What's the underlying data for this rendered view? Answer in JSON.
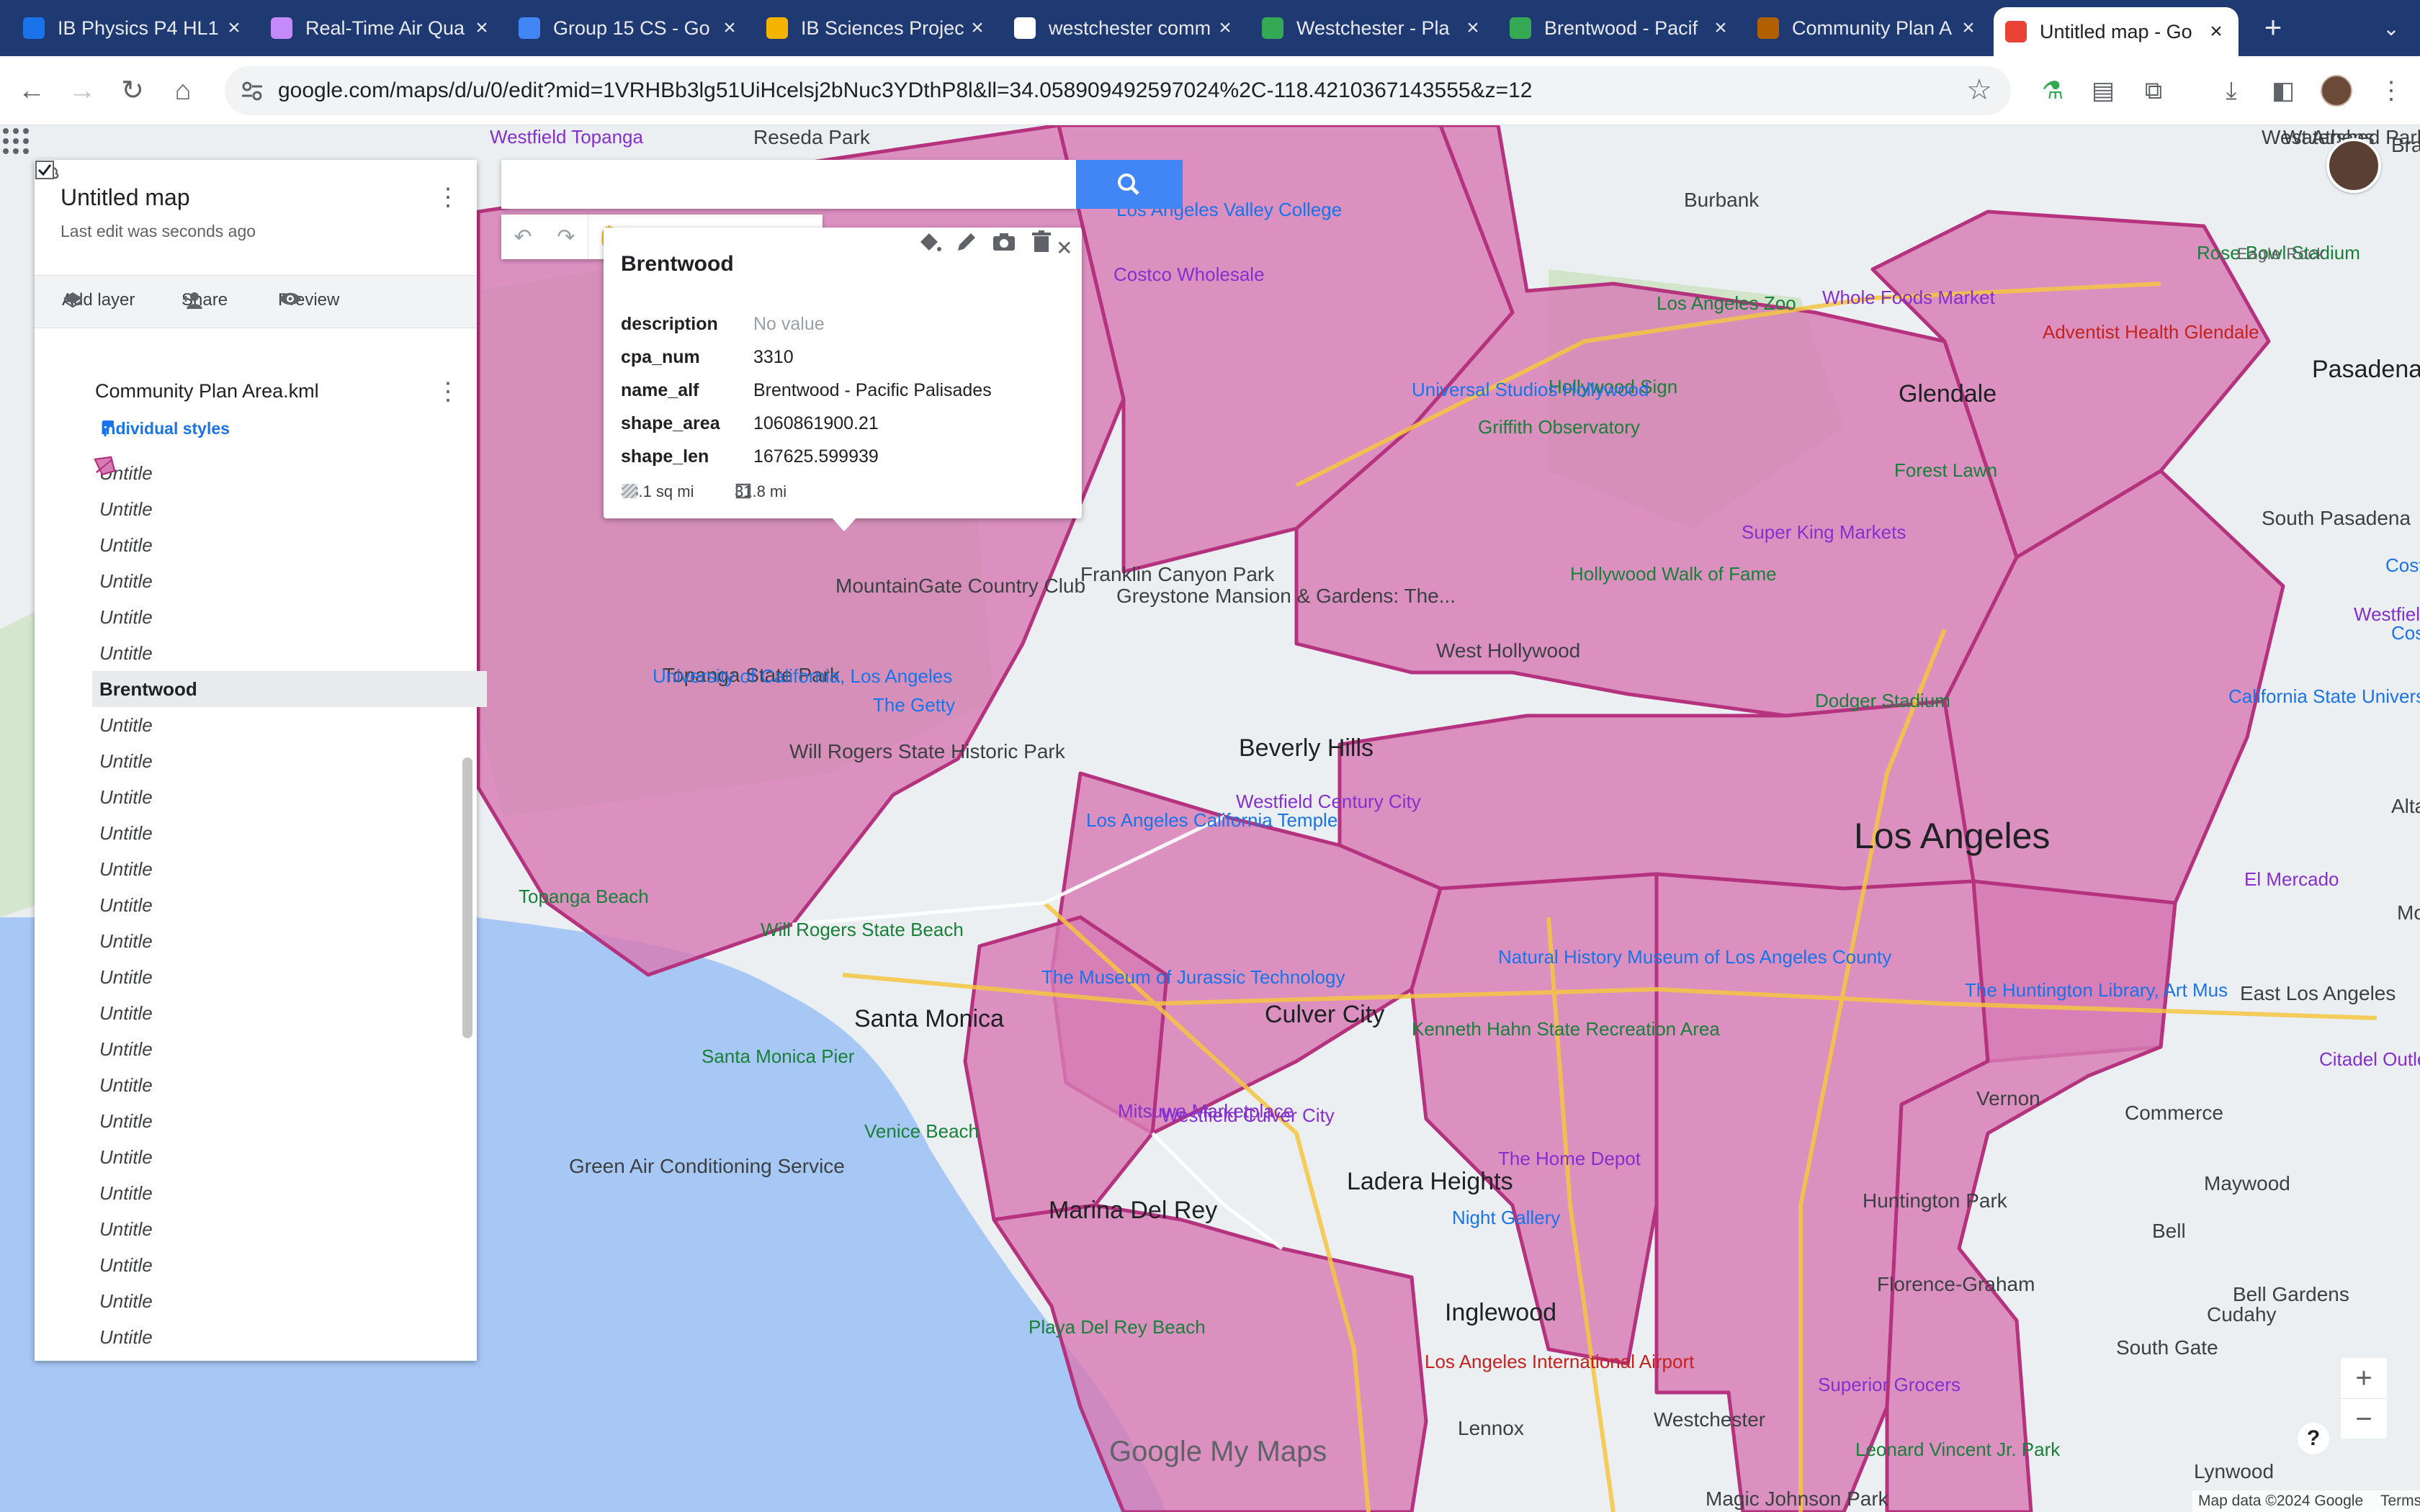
{
  "browser": {
    "tabs": [
      {
        "label": "IB Physics P4 HL1",
        "favicon": "blue-classroom-icon",
        "color": "#1a73e8"
      },
      {
        "label": "Real-Time Air Qua",
        "favicon": "cloud-icon",
        "color": "#c58af9"
      },
      {
        "label": "Group 15 CS - Go",
        "favicon": "docs-icon",
        "color": "#4285f4"
      },
      {
        "label": "IB Sciences Projec",
        "favicon": "slides-icon",
        "color": "#f4b400"
      },
      {
        "label": "westchester comm",
        "favicon": "google-icon",
        "color": "#ffffff"
      },
      {
        "label": "Westchester - Pla",
        "favicon": "maps-icon",
        "color": "#34a853"
      },
      {
        "label": "Brentwood - Pacif",
        "favicon": "maps-icon",
        "color": "#34a853"
      },
      {
        "label": "Community Plan A",
        "favicon": "city-seal-icon",
        "color": "#b06000"
      },
      {
        "label": "Untitled map - Go",
        "favicon": "mymaps-icon",
        "color": "#ea4335"
      }
    ],
    "active_tab_index": 8,
    "url": "google.com/maps/d/u/0/edit?mid=1VRHBb3lg51UiHcelsj2bNuc3YDthP8l&ll=34.058909492597024%2C-118.4210367143555&z=12"
  },
  "panel": {
    "title": "Untitled map",
    "subtitle": "Last edit was seconds ago",
    "actions": {
      "add_layer": "Add layer",
      "share": "Share",
      "preview": "Preview"
    },
    "layer": {
      "name": "Community Plan Area.kml",
      "checked": true,
      "styles_link": "Individual styles"
    },
    "features": [
      "Untitle",
      "Untitle",
      "Untitle",
      "Untitle",
      "Untitle",
      "Untitle",
      "Brentwood",
      "Untitle",
      "Untitle",
      "Untitle",
      "Untitle",
      "Untitle",
      "Untitle",
      "Untitle",
      "Untitle",
      "Untitle",
      "Untitle",
      "Untitle",
      "Untitle",
      "Untitle",
      "Untitle",
      "Untitle",
      "Untitle",
      "Untitle",
      "Untitle",
      "Untitle"
    ],
    "selected_index": 6
  },
  "search": {
    "placeholder": ""
  },
  "info_window": {
    "title": "Brentwood",
    "rows": [
      {
        "key": "description",
        "value": "No value",
        "empty": true
      },
      {
        "key": "cpa_num",
        "value": "3310"
      },
      {
        "key": "name_alf",
        "value": "Brentwood - Pacific Palisades"
      },
      {
        "key": "shape_area",
        "value": "1060861900.21"
      },
      {
        "key": "shape_len",
        "value": "167625.599939"
      }
    ],
    "area": "38.1 sq mi",
    "perimeter": "31.8 mi"
  },
  "map": {
    "labels": [
      {
        "text": "Los Angeles",
        "style": "big"
      },
      {
        "text": "Glendale",
        "style": "city"
      },
      {
        "text": "Pasadena",
        "style": "city"
      },
      {
        "text": "Burbank",
        "style": "plain"
      },
      {
        "text": "Beverly Hills",
        "style": "city"
      },
      {
        "text": "West Hollywood",
        "style": "plain"
      },
      {
        "text": "Santa Monica",
        "style": "city"
      },
      {
        "text": "Culver City",
        "style": "city"
      },
      {
        "text": "Ladera Heights",
        "style": "city"
      },
      {
        "text": "Inglewood",
        "style": "city"
      },
      {
        "text": "Marina Del Rey",
        "style": "city"
      },
      {
        "text": "Venice Beach",
        "style": "green"
      },
      {
        "text": "Santa Monica Pier",
        "style": "green"
      },
      {
        "text": "Westchester",
        "style": "plain"
      },
      {
        "text": "Lennox",
        "style": "plain"
      },
      {
        "text": "Vernon",
        "style": "plain"
      },
      {
        "text": "Commerce",
        "style": "plain"
      },
      {
        "text": "Maywood",
        "style": "plain"
      },
      {
        "text": "Bell",
        "style": "plain"
      },
      {
        "text": "Huntington Park",
        "style": "plain"
      },
      {
        "text": "Florence-Graham",
        "style": "plain"
      },
      {
        "text": "Cudahy",
        "style": "plain"
      },
      {
        "text": "South Gate",
        "style": "plain"
      },
      {
        "text": "Bell Gardens",
        "style": "plain"
      },
      {
        "text": "Lynwood",
        "style": "plain"
      },
      {
        "text": "South Pasadena",
        "style": "plain"
      },
      {
        "text": "East Los Angeles",
        "style": "plain"
      },
      {
        "text": "Los Angeles Zoo",
        "style": "green"
      },
      {
        "text": "Griffith Observatory",
        "style": "green"
      },
      {
        "text": "Hollywood Sign",
        "style": "green"
      },
      {
        "text": "Hollywood Walk of Fame",
        "style": "green"
      },
      {
        "text": "Dodger Stadium",
        "style": "green"
      },
      {
        "text": "Rose Bowl Stadium",
        "style": "green"
      },
      {
        "text": "Whole Foods Market",
        "style": "shop"
      },
      {
        "text": "Costco Wholesale",
        "style": "shop"
      },
      {
        "text": "Westfield Fashion Square",
        "style": "shop"
      },
      {
        "text": "Westfield Century City",
        "style": "shop"
      },
      {
        "text": "Westfield Culver City",
        "style": "shop"
      },
      {
        "text": "Mitsuwa Marketplace",
        "style": "shop"
      },
      {
        "text": "Super King Markets",
        "style": "shop"
      },
      {
        "text": "The Home Depot",
        "style": "shop"
      },
      {
        "text": "Superior Grocers",
        "style": "shop"
      },
      {
        "text": "El Mercado",
        "style": "shop"
      },
      {
        "text": "Citadel Outlets",
        "style": "shop"
      },
      {
        "text": "Adventist Health Glendale",
        "style": "red"
      },
      {
        "text": "Los Angeles International Airport",
        "style": "red"
      },
      {
        "text": "Topanga State Park",
        "style": "plain"
      },
      {
        "text": "Will Rogers State Historic Park",
        "style": "plain"
      },
      {
        "text": "The Getty",
        "style": "poi"
      },
      {
        "text": "University of California, Los Angeles",
        "style": "poi"
      },
      {
        "text": "Los Angeles California Temple",
        "style": "poi"
      },
      {
        "text": "The Museum of Jurassic Technology",
        "style": "poi"
      },
      {
        "text": "Natural History Museum of Los Angeles County",
        "style": "poi"
      },
      {
        "text": "Kenneth Hahn State Recreation Area",
        "style": "green"
      },
      {
        "text": "Green Air Conditioning Service",
        "style": "plain"
      },
      {
        "text": "Playa Del Rey Beach",
        "style": "green"
      },
      {
        "text": "Topanga Beach",
        "style": "green"
      },
      {
        "text": "Westfield Topanga",
        "style": "shop"
      },
      {
        "text": "Reseda Park",
        "style": "plain"
      },
      {
        "text": "Los Angeles Valley College",
        "style": "poi"
      },
      {
        "text": "Universal Studios Hollywood",
        "style": "poi"
      },
      {
        "text": "Greystone Mansion & Gardens: The...",
        "style": "plain"
      },
      {
        "text": "Franklin Canyon Park",
        "style": "plain"
      },
      {
        "text": "MountainGate Country Club",
        "style": "plain"
      },
      {
        "text": "Will Rogers State Beach",
        "style": "green"
      },
      {
        "text": "Forest Lawn",
        "style": "green"
      },
      {
        "text": "Eagle Rock",
        "style": "small"
      },
      {
        "text": "California State University, Los Angeles",
        "style": "poi"
      },
      {
        "text": "Costco Wholesale",
        "style": "poi"
      },
      {
        "text": "The Huntington Library, Art Mus",
        "style": "poi"
      },
      {
        "text": "Night Gallery",
        "style": "poi"
      },
      {
        "text": "Leonard Vincent Jr. Park",
        "style": "green"
      },
      {
        "text": "Magic Johnson Park",
        "style": "plain"
      },
      {
        "text": "West Athens",
        "style": "plain"
      },
      {
        "text": "Watershed Park",
        "style": "plain"
      },
      {
        "text": "Brand Park",
        "style": "plain"
      },
      {
        "text": "Alta",
        "style": "plain"
      },
      {
        "text": "Mo",
        "style": "plain"
      },
      {
        "text": "Costco",
        "style": "poi"
      },
      {
        "text": "Al",
        "style": "plain"
      }
    ],
    "logo": "Google",
    "logo_suffix": "My Maps",
    "attribution": "Map data ©2024 Google",
    "terms": "Terms",
    "colors": {
      "region_fill": "#d77bb4",
      "region_stroke": "#b5327f",
      "water": "#a7c7f5",
      "land": "#eceff1"
    }
  },
  "controls": {
    "zoom_in": "+",
    "zoom_out": "−",
    "help": "?"
  }
}
